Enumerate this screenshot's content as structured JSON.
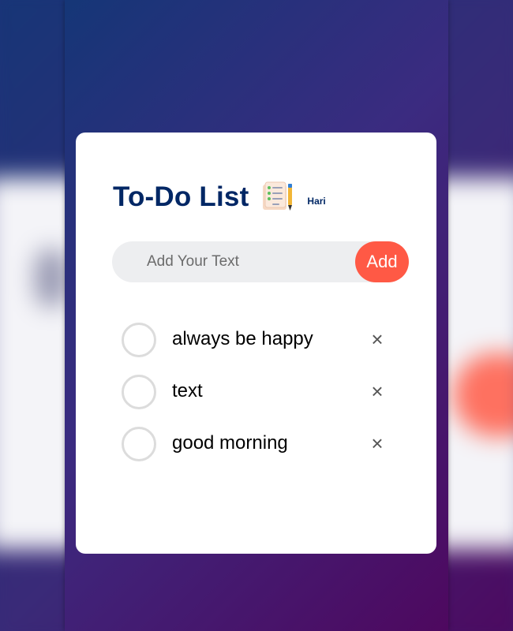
{
  "app": {
    "title": "To-Do List",
    "title_tag": "Hari"
  },
  "input": {
    "placeholder": "Add Your Text",
    "value": "",
    "add_label": "Add"
  },
  "todos": [
    {
      "text": "always be happy",
      "checked": false,
      "remove_label": "×"
    },
    {
      "text": "text",
      "checked": false,
      "remove_label": "×"
    },
    {
      "text": "good morning",
      "checked": false,
      "remove_label": "×"
    }
  ],
  "icons": {
    "title_icon": "checklist-pencil-icon",
    "remove_icon": "close-icon"
  },
  "colors": {
    "accent": "#ff5945",
    "title": "#002765",
    "gradient_start": "#153677",
    "gradient_end": "#4e085f",
    "input_bg": "#edeef0"
  }
}
